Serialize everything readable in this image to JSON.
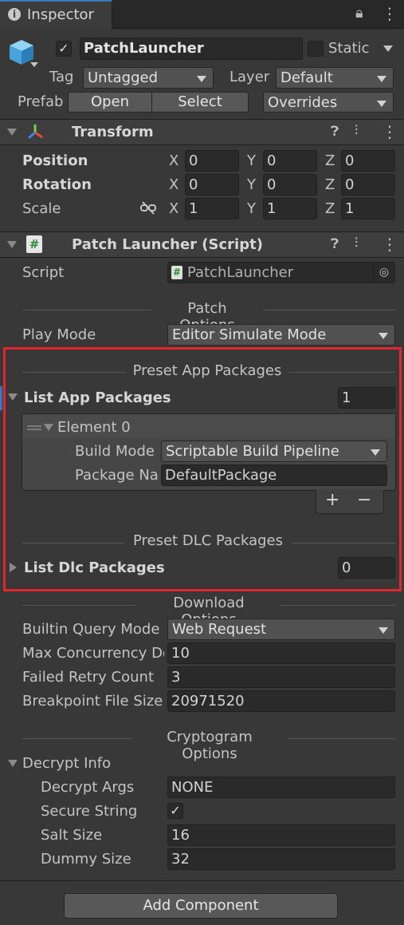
{
  "tab": {
    "title": "Inspector"
  },
  "object": {
    "name": "PatchLauncher",
    "static_label": "Static",
    "tag_label": "Tag",
    "tag_value": "Untagged",
    "layer_label": "Layer",
    "layer_value": "Default",
    "prefab_label": "Prefab",
    "open_label": "Open",
    "select_label": "Select",
    "overrides_label": "Overrides"
  },
  "transform": {
    "title": "Transform",
    "position_label": "Position",
    "rotation_label": "Rotation",
    "scale_label": "Scale",
    "axis_x": "X",
    "axis_y": "Y",
    "axis_z": "Z",
    "position": [
      "0",
      "0",
      "0"
    ],
    "rotation": [
      "0",
      "0",
      "0"
    ],
    "scale": [
      "1",
      "1",
      "1"
    ]
  },
  "script_comp": {
    "title": "Patch Launcher (Script)",
    "script_label": "Script",
    "script_value": "PatchLauncher",
    "patch_options": "Patch Options",
    "play_mode_label": "Play Mode",
    "play_mode_value": "Editor Simulate Mode",
    "preset_app": "Preset App Packages",
    "list_app_label": "List App Packages",
    "list_app_count": "1",
    "element0": "Element 0",
    "build_mode_label": "Build Mode",
    "build_mode_value": "Scriptable Build Pipeline",
    "package_name_label": "Package Na",
    "package_name_value": "DefaultPackage",
    "plus": "+",
    "minus": "−",
    "preset_dlc": "Preset DLC Packages",
    "list_dlc_label": "List Dlc Packages",
    "list_dlc_count": "0",
    "download_options": "Download Options",
    "builtin_query_label": "Builtin Query Mode",
    "builtin_query_value": "Web Request",
    "max_concurrency_label": "Max Concurrency Do",
    "max_concurrency_value": "10",
    "failed_retry_label": "Failed Retry Count",
    "failed_retry_value": "3",
    "breakpoint_label": "Breakpoint File Size",
    "breakpoint_value": "20971520",
    "cryptogram_options": "Cryptogram Options",
    "decrypt_info_label": "Decrypt Info",
    "decrypt_args_label": "Decrypt Args",
    "decrypt_args_value": "NONE",
    "secure_string_label": "Secure String",
    "salt_size_label": "Salt Size",
    "salt_size_value": "16",
    "dummy_size_label": "Dummy Size",
    "dummy_size_value": "32"
  },
  "add_component": "Add Component",
  "colors": {
    "highlight": "#e3262d",
    "background": "#383838",
    "field": "#2a2a2a"
  }
}
